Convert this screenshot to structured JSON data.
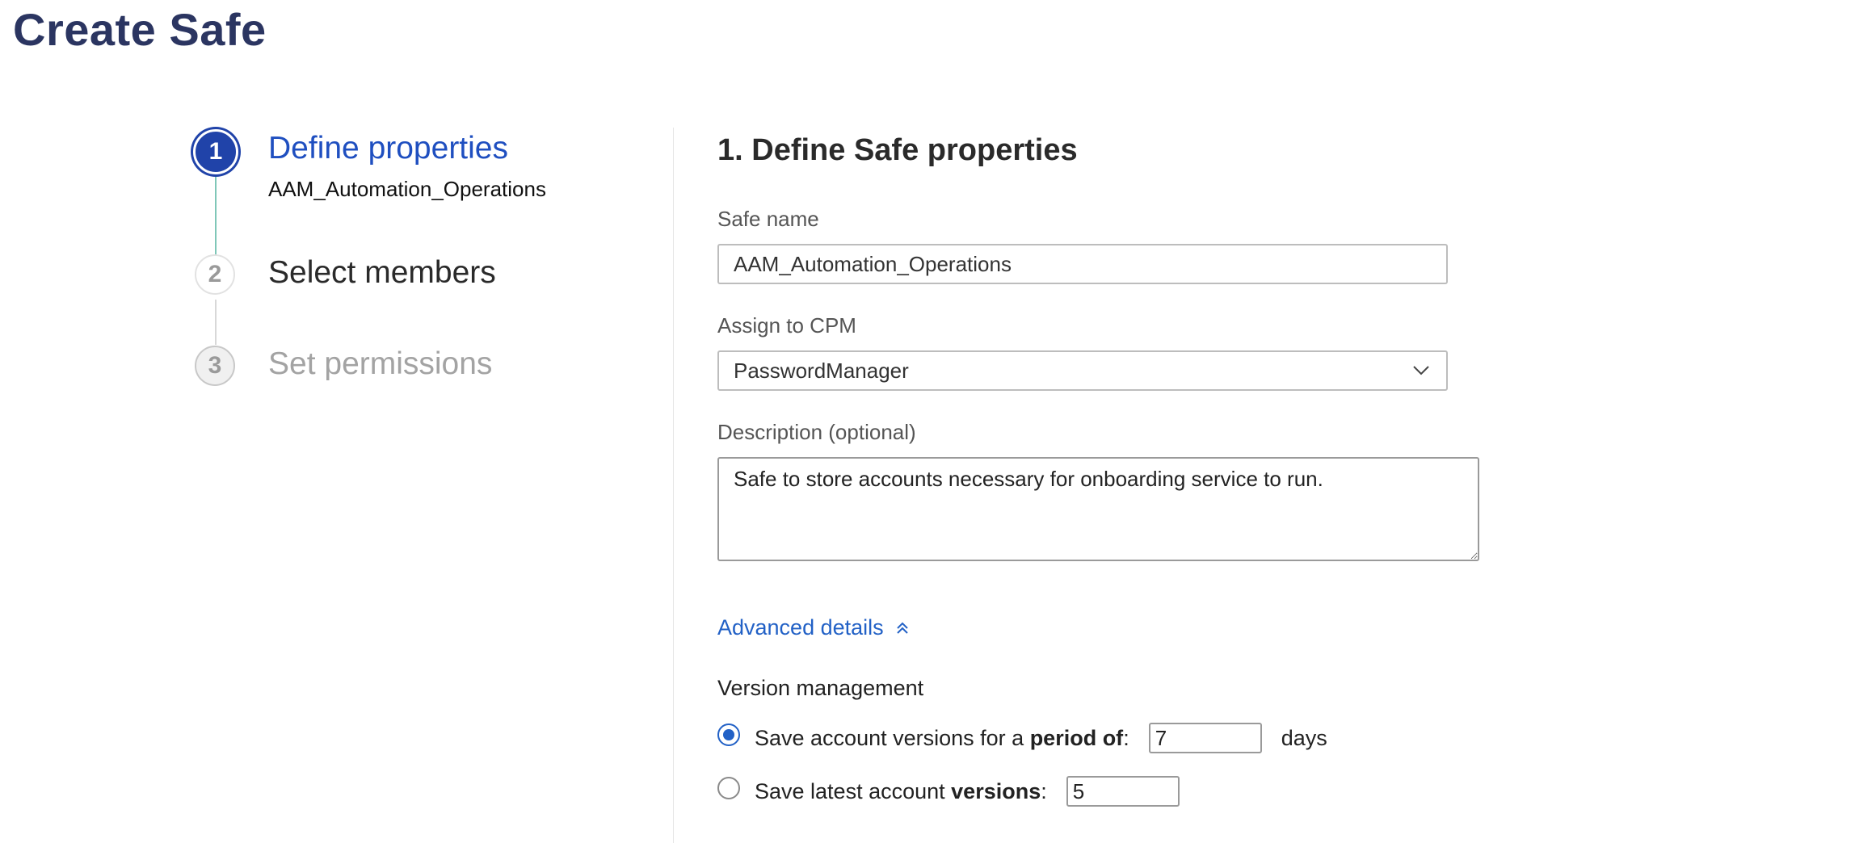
{
  "page": {
    "title": "Create Safe"
  },
  "stepper": {
    "steps": [
      {
        "number": "1",
        "title": "Define properties",
        "subtitle": "AAM_Automation_Operations",
        "state": "active"
      },
      {
        "number": "2",
        "title": "Select members",
        "state": "pending"
      },
      {
        "number": "3",
        "title": "Set permissions",
        "state": "disabled"
      }
    ]
  },
  "form": {
    "section_title": "1. Define Safe properties",
    "safe_name": {
      "label": "Safe name",
      "value": "AAM_Automation_Operations"
    },
    "cpm": {
      "label": "Assign to CPM",
      "value": "PasswordManager"
    },
    "description": {
      "label": "Description (optional)",
      "value": "Safe to store accounts necessary for onboarding service to run."
    },
    "advanced": {
      "label": "Advanced details",
      "icon": "double-chevron-up-icon"
    },
    "version_management": {
      "title": "Version management",
      "option_period": {
        "prefix": "Save account versions for a ",
        "bold": "period of",
        "suffix": ":",
        "value": "7",
        "unit": "days",
        "selected": true
      },
      "option_versions": {
        "prefix": "Save latest account ",
        "bold": "versions",
        "suffix": ":",
        "value": "5",
        "selected": false
      }
    }
  },
  "colors": {
    "accent": "#2043a9",
    "link": "#2261c6",
    "title": "#2b3561",
    "progress": "#7fc7b8"
  }
}
